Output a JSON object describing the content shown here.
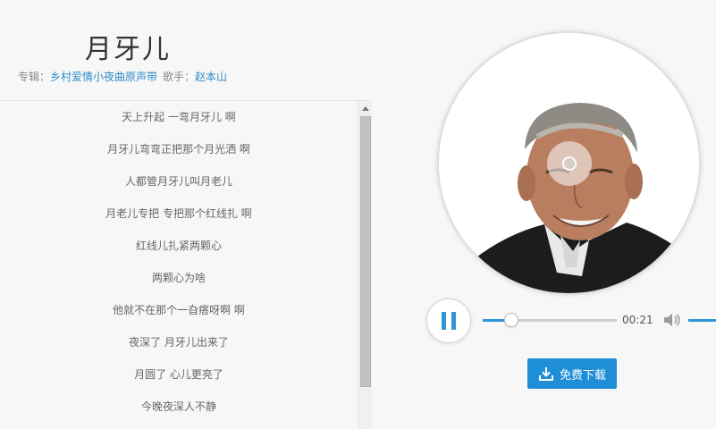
{
  "song": {
    "title": "月牙儿",
    "album_label": "专辑：",
    "album": "乡村爱情小夜曲原声带",
    "singer_label": "歌手：",
    "singer": "赵本山"
  },
  "lyrics": [
    "天上升起 一弯月牙儿 啊",
    "月牙儿弯弯正把那个月光洒 啊",
    "人都管月牙儿叫月老儿",
    "月老儿专把 专把那个红线扎 啊",
    "红线儿扎紧两颗心",
    "两颗心为啥",
    "他就不在那个一旮瘩呀啊 啊",
    "夜深了 月牙儿出来了",
    "月圆了 心儿更亮了",
    "今晚夜深人不静"
  ],
  "player": {
    "time": "00:21",
    "progress": 0.21,
    "state": "playing",
    "controls_icon": "pause-icon",
    "volume_icon": "speaker-icon"
  },
  "download": {
    "label": "免费下载",
    "icon": "download-icon"
  },
  "colors": {
    "accent": "#2e96d8",
    "link": "#2e8bc9",
    "button": "#1e8fd6"
  }
}
